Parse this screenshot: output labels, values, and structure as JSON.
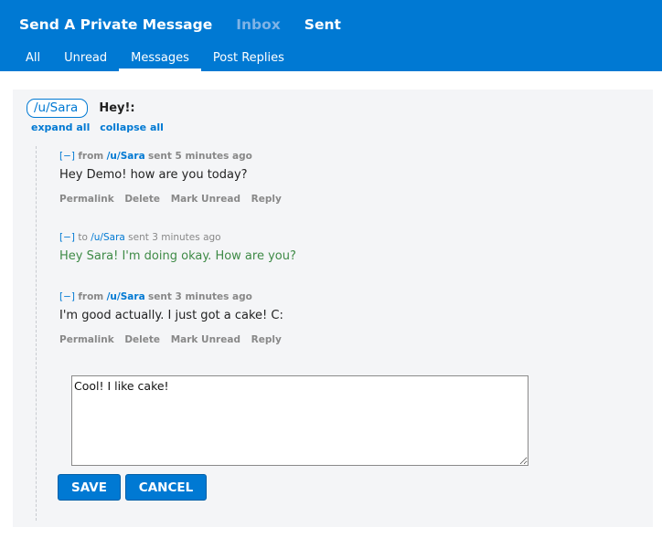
{
  "header": {
    "links": [
      "Send A Private Message",
      "Inbox",
      "Sent"
    ],
    "tabs": [
      "All",
      "Unread",
      "Messages",
      "Post Replies"
    ],
    "active_tab": "Messages"
  },
  "thread": {
    "user": "/u/Sara",
    "subject": "Hey!:",
    "expand_all": "expand all",
    "collapse_all": "collapse all"
  },
  "messages": [
    {
      "toggle": "[−]",
      "direction": "from",
      "user": "/u/Sara",
      "sent": "sent 5 minutes ago",
      "body": "Hey Demo! how are you today?",
      "actions": [
        "Permalink",
        "Delete",
        "Mark Unread",
        "Reply"
      ]
    },
    {
      "toggle": "[−]",
      "direction": "to",
      "user": "/u/Sara",
      "sent": "sent 3 minutes ago",
      "body": "Hey Sara! I'm doing okay. How are you?"
    },
    {
      "toggle": "[−]",
      "direction": "from",
      "user": "/u/Sara",
      "sent": "sent 3 minutes ago",
      "body": "I'm good actually. I just got a cake! C:",
      "actions": [
        "Permalink",
        "Delete",
        "Mark Unread",
        "Reply"
      ]
    }
  ],
  "reply": {
    "value": "Cool! I like cake!",
    "save_label": "SAVE",
    "cancel_label": "CANCEL"
  }
}
